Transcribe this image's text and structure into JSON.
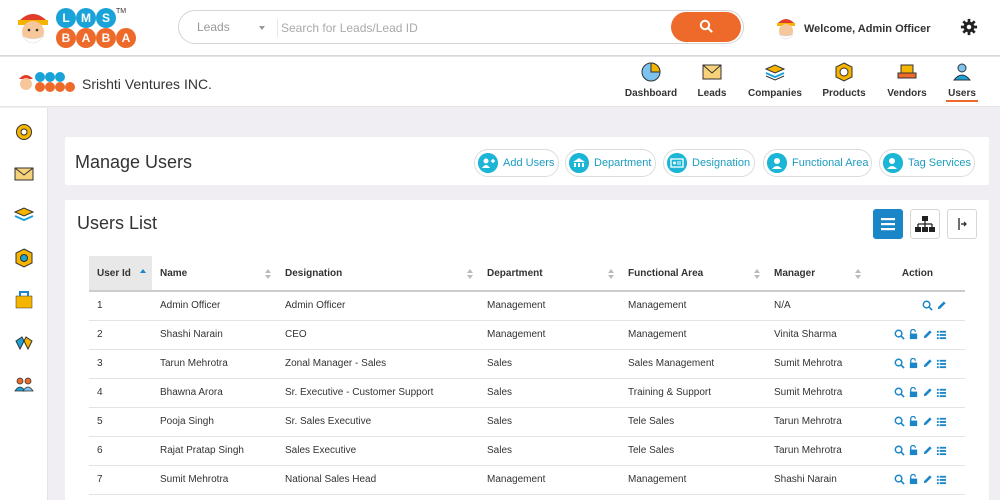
{
  "colors": {
    "accent": "#ee6a2a",
    "info": "#1bb5d6",
    "primary": "#1a86c8"
  },
  "logo": {
    "letters": [
      "L",
      "M",
      "S",
      "B",
      "A",
      "B",
      "A"
    ],
    "tm": "TM"
  },
  "search": {
    "category": "Leads",
    "placeholder": "Search for Leads/Lead ID",
    "icon": "search-icon"
  },
  "header": {
    "welcome": "Welcome, Admin Officer",
    "settings_icon": "gear-icon"
  },
  "company": {
    "name": "Srishti Ventures INC."
  },
  "nav": [
    {
      "label": "Dashboard",
      "icon": "pie-chart-icon"
    },
    {
      "label": "Leads",
      "icon": "envelope-icon"
    },
    {
      "label": "Companies",
      "icon": "stack-icon"
    },
    {
      "label": "Products",
      "icon": "package-icon"
    },
    {
      "label": "Vendors",
      "icon": "truck-icon"
    },
    {
      "label": "Users",
      "icon": "user-icon",
      "active": true
    }
  ],
  "sidebar": [
    "gear-icon",
    "envelope-icon",
    "stack-icon",
    "package-icon",
    "briefcase-icon",
    "handshake-icon",
    "users-icon"
  ],
  "manage": {
    "title": "Manage Users",
    "buttons": [
      {
        "label": "Add Users"
      },
      {
        "label": "Department"
      },
      {
        "label": "Designation"
      },
      {
        "label": "Functional Area"
      },
      {
        "label": "Tag Services"
      }
    ]
  },
  "users_list": {
    "title": "Users List",
    "columns": [
      "User Id",
      "Name",
      "Designation",
      "Department",
      "Functional Area",
      "Manager",
      "Action"
    ],
    "rows": [
      {
        "id": "1",
        "name": "Admin Officer",
        "designation": "Admin Officer",
        "department": "Management",
        "functional_area": "Management",
        "manager": "N/A",
        "actions": [
          "view",
          "edit"
        ]
      },
      {
        "id": "2",
        "name": "Shashi Narain",
        "designation": "CEO",
        "department": "Management",
        "functional_area": "Management",
        "manager": "Vinita Sharma",
        "actions": [
          "view",
          "unlock",
          "edit",
          "list"
        ]
      },
      {
        "id": "3",
        "name": "Tarun Mehrotra",
        "designation": "Zonal Manager - Sales",
        "department": "Sales",
        "functional_area": "Sales Management",
        "manager": "Sumit Mehrotra",
        "actions": [
          "view",
          "unlock",
          "edit",
          "list"
        ]
      },
      {
        "id": "4",
        "name": "Bhawna Arora",
        "designation": "Sr. Executive - Customer Support",
        "department": "Sales",
        "functional_area": "Training & Support",
        "manager": "Sumit Mehrotra",
        "actions": [
          "view",
          "unlock",
          "edit",
          "list"
        ]
      },
      {
        "id": "5",
        "name": "Pooja Singh",
        "designation": "Sr. Sales Executive",
        "department": "Sales",
        "functional_area": "Tele Sales",
        "manager": "Tarun Mehrotra",
        "actions": [
          "view",
          "unlock",
          "edit",
          "list"
        ]
      },
      {
        "id": "6",
        "name": "Rajat Pratap Singh",
        "designation": "Sales Executive",
        "department": "Sales",
        "functional_area": "Tele Sales",
        "manager": "Tarun Mehrotra",
        "actions": [
          "view",
          "unlock",
          "edit",
          "list"
        ]
      },
      {
        "id": "7",
        "name": "Sumit Mehrotra",
        "designation": "National Sales Head",
        "department": "Management",
        "functional_area": "Management",
        "manager": "Shashi Narain",
        "actions": [
          "view",
          "unlock",
          "edit",
          "list"
        ]
      }
    ]
  }
}
